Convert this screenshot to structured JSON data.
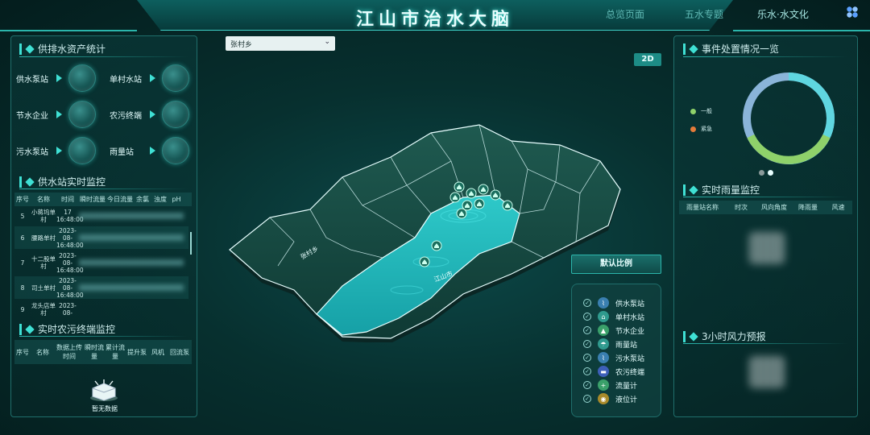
{
  "header": {
    "title": "江山市治水大脑",
    "nav": [
      "总览页面",
      "五水专题",
      "乐水·水文化"
    ]
  },
  "dropdown": {
    "value": "张村乡"
  },
  "mode_button": "2D",
  "left": {
    "asset_section": {
      "title": "供排水资产统计",
      "items": [
        "供水泵站",
        "单村水站",
        "节水企业",
        "农污终端",
        "污水泵站",
        "雨量站"
      ]
    },
    "supply_section": {
      "title": "供水站实时监控",
      "columns": [
        "序号",
        "名称",
        "时间",
        "瞬时流量",
        "今日流量",
        "余氯",
        "浊度",
        "pH"
      ],
      "rows": [
        {
          "no": "5",
          "name": "小蒋坞单村",
          "time": "17 16:48:00"
        },
        {
          "no": "6",
          "name": "腰路单村",
          "time": "2023-08- 16:48:00"
        },
        {
          "no": "7",
          "name": "十二股单村",
          "time": "2023-08- 16:48:00"
        },
        {
          "no": "8",
          "name": "司土单村",
          "time": "2023-08- 16:48:00"
        },
        {
          "no": "9",
          "name": "龙头店单村",
          "time": "2023-08-"
        }
      ]
    },
    "sewage_section": {
      "title": "实时农污终端监控",
      "columns": [
        "序号",
        "名称",
        "数据上传时间",
        "瞬时流量",
        "累计流量",
        "提升泵",
        "风机",
        "回流泵"
      ],
      "empty_text": "暂无数据"
    }
  },
  "center": {
    "default_scale_button": "默认比例",
    "map_labels": [
      "张村乡",
      "江山市"
    ],
    "legend": [
      {
        "label": "供水泵站",
        "color": "#3a7fb0",
        "icon": "pump-icon"
      },
      {
        "label": "单村水站",
        "color": "#2f9a8e",
        "icon": "house-icon"
      },
      {
        "label": "节水企业",
        "color": "#3aa06a",
        "icon": "factory-icon"
      },
      {
        "label": "雨量站",
        "color": "#2f9a8e",
        "icon": "rain-icon"
      },
      {
        "label": "污水泵站",
        "color": "#3a7fb0",
        "icon": "sewage-icon"
      },
      {
        "label": "农污终端",
        "color": "#3d5fb8",
        "icon": "terminal-icon"
      },
      {
        "label": "流量计",
        "color": "#3aa06a",
        "icon": "flowmeter-icon"
      },
      {
        "label": "液位计",
        "color": "#a88a2a",
        "icon": "level-icon"
      }
    ]
  },
  "right": {
    "events": {
      "title": "事件处置情况一览",
      "legend": [
        {
          "label": "一般",
          "color": "#8fd16a"
        },
        {
          "label": "紧急",
          "color": "#e37b3a"
        }
      ]
    },
    "rain": {
      "title": "实时雨量监控",
      "columns": [
        "雨量站名称",
        "时次",
        "风向角度",
        "降雨量",
        "风速"
      ]
    },
    "wind": {
      "title": "3小时风力预报"
    }
  },
  "colors": {
    "accent": "#3fe0d4",
    "panel_border": "#1f6e6b",
    "button": "#1d8c86"
  }
}
